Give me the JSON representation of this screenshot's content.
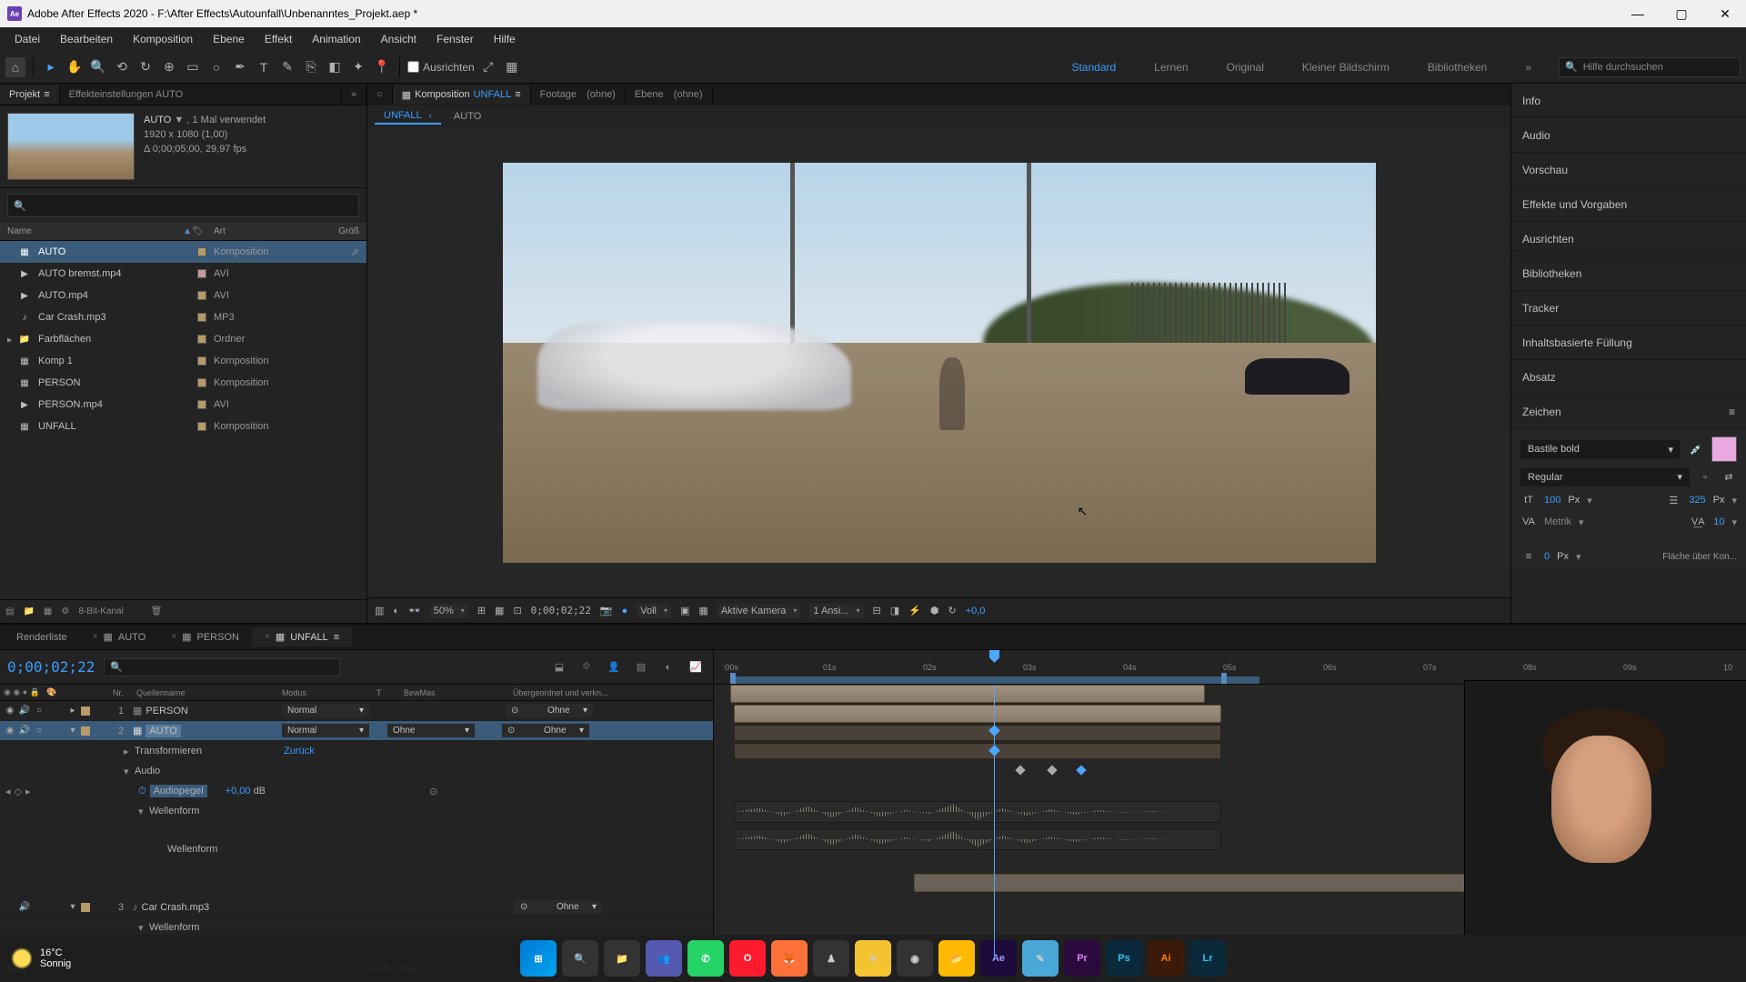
{
  "title": "Adobe After Effects 2020 - F:\\After Effects\\Autounfall\\Unbenanntes_Projekt.aep *",
  "menu": [
    "Datei",
    "Bearbeiten",
    "Komposition",
    "Ebene",
    "Effekt",
    "Animation",
    "Ansicht",
    "Fenster",
    "Hilfe"
  ],
  "toolbar": {
    "align_label": "Ausrichten",
    "workspaces": [
      "Standard",
      "Lernen",
      "Original",
      "Kleiner Bildschirm",
      "Bibliotheken"
    ],
    "active_workspace": "Standard",
    "search_placeholder": "Hilfe durchsuchen"
  },
  "project": {
    "tab_project": "Projekt",
    "tab_effect": "Effekteinstellungen AUTO",
    "selected_name": "AUTO",
    "selected_usage": ", 1 Mal verwendet",
    "selected_dims": "1920 x 1080 (1,00)",
    "selected_dur": "Δ 0;00;05;00, 29,97 fps",
    "cols": {
      "name": "Name",
      "type": "Art",
      "size": "Größ"
    },
    "items": [
      {
        "name": "AUTO",
        "type": "Komposition",
        "color": "#b59a6a",
        "icon": "comp",
        "selected": true,
        "flow": true
      },
      {
        "name": "AUTO bremst.mp4",
        "type": "AVI",
        "color": "#c99a9a",
        "icon": "video"
      },
      {
        "name": "AUTO.mp4",
        "type": "AVI",
        "color": "#b59a6a",
        "icon": "video"
      },
      {
        "name": "Car Crash.mp3",
        "type": "MP3",
        "color": "#b59a6a",
        "icon": "audio"
      },
      {
        "name": "Farbflächen",
        "type": "Ordner",
        "color": "#b59a6a",
        "icon": "folder",
        "twirl": true
      },
      {
        "name": "Komp 1",
        "type": "Komposition",
        "color": "#b59a6a",
        "icon": "comp"
      },
      {
        "name": "PERSON",
        "type": "Komposition",
        "color": "#b59a6a",
        "icon": "comp"
      },
      {
        "name": "PERSON.mp4",
        "type": "AVI",
        "color": "#b59a6a",
        "icon": "video"
      },
      {
        "name": "UNFALL",
        "type": "Komposition",
        "color": "#b59a6a",
        "icon": "comp"
      }
    ],
    "footer_depth": "8-Bit-Kanal"
  },
  "comp": {
    "tab_comp_prefix": "Komposition",
    "tab_comp_name": "UNFALL",
    "tab_footage": "Footage",
    "tab_footage_none": "(ohne)",
    "tab_layer": "Ebene",
    "breadcrumb": [
      "UNFALL",
      "AUTO"
    ],
    "footer": {
      "zoom": "50%",
      "timecode": "0;00;02;22",
      "resolution": "Voll",
      "camera": "Aktive Kamera",
      "views": "1 Ansi...",
      "adjust": "+0,0"
    }
  },
  "right": {
    "panels": [
      "Info",
      "Audio",
      "Vorschau",
      "Effekte und Vorgaben",
      "Ausrichten",
      "Bibliotheken",
      "Tracker",
      "Inhaltsbasierte Füllung",
      "Absatz",
      "Zeichen"
    ],
    "char": {
      "font": "Bastile bold",
      "style": "Regular",
      "size": "100",
      "size_unit": "Px",
      "leading": "325",
      "leading_unit": "Px",
      "kerning": "Metrik",
      "tracking": "10",
      "color": "#e8a8e0"
    },
    "para": {
      "indent": "0",
      "indent_unit": "Px",
      "fill_over": "Fläche über Kon..."
    }
  },
  "timeline": {
    "tabs": [
      "Renderliste",
      "AUTO",
      "PERSON",
      "UNFALL"
    ],
    "active_tab": "UNFALL",
    "timecode": "0;00;02;22",
    "head": {
      "nr": "Nr.",
      "src": "Quellenname",
      "mode": "Modus",
      "t": "T",
      "trk": "BewMas",
      "parent": "Übergeordnet und verkn..."
    },
    "layers": [
      {
        "nr": "1",
        "name": "PERSON",
        "mode": "Normal",
        "parent": "Ohne",
        "color": "#b59a6a"
      },
      {
        "nr": "2",
        "name": "AUTO",
        "mode": "Normal",
        "trk": "Ohne",
        "parent": "Ohne",
        "color": "#b59a6a",
        "selected": true
      },
      {
        "nr": "3",
        "name": "Car Crash.mp3",
        "parent": "Ohne",
        "color": "#b59a6a",
        "audio_only": true
      }
    ],
    "props": {
      "transform": "Transformieren",
      "transform_reset": "Zurück",
      "audio": "Audio",
      "audio_level": "Audiopegel",
      "audio_level_val": "+0,00",
      "audio_level_unit": "dB",
      "waveform": "Wellenform"
    },
    "ruler": [
      ":00s",
      "01s",
      "02s",
      "03s",
      "04s",
      "05s",
      "06s",
      "07s",
      "08s",
      "09s",
      "10"
    ],
    "footer_label": "Schalter/Modi"
  },
  "taskbar": {
    "temp": "16°C",
    "weather": "Sonnig"
  }
}
